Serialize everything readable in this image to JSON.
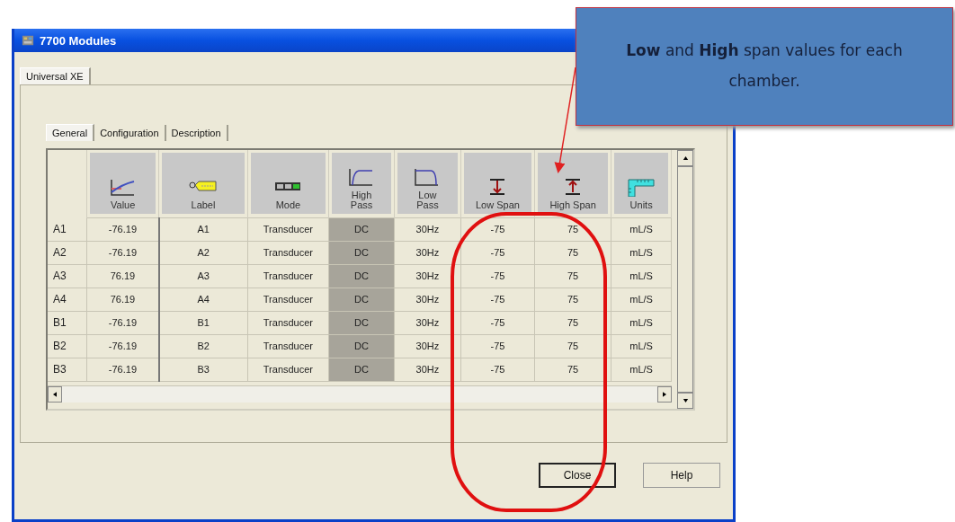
{
  "window": {
    "title": "7700 Modules"
  },
  "outer_tabs": [
    {
      "label": "Universal XE",
      "selected": true
    }
  ],
  "inner_tabs": [
    {
      "label": "General",
      "selected": true
    },
    {
      "label": "Configuration",
      "selected": false
    },
    {
      "label": "Description",
      "selected": false
    }
  ],
  "table": {
    "columns": [
      {
        "kind": "value",
        "label": "Value",
        "selected": false
      },
      {
        "kind": "label",
        "label": "Label",
        "selected": false
      },
      {
        "kind": "mode",
        "label": "Mode",
        "selected": false
      },
      {
        "kind": "highpass",
        "label": "High Pass",
        "selected": true
      },
      {
        "kind": "lowpass",
        "label": "Low Pass",
        "selected": false
      },
      {
        "kind": "lowspan",
        "label": "Low Span",
        "selected": false
      },
      {
        "kind": "highspan",
        "label": "High Span",
        "selected": false
      },
      {
        "kind": "units",
        "label": "Units",
        "selected": false
      }
    ],
    "rows": [
      {
        "header": "A1",
        "cells": [
          "-76.19",
          "A1",
          "Transducer",
          "DC",
          "30Hz",
          "-75",
          "75",
          "mL/S"
        ]
      },
      {
        "header": "A2",
        "cells": [
          "-76.19",
          "A2",
          "Transducer",
          "DC",
          "30Hz",
          "-75",
          "75",
          "mL/S"
        ]
      },
      {
        "header": "A3",
        "cells": [
          "76.19",
          "A3",
          "Transducer",
          "DC",
          "30Hz",
          "-75",
          "75",
          "mL/S"
        ]
      },
      {
        "header": "A4",
        "cells": [
          "76.19",
          "A4",
          "Transducer",
          "DC",
          "30Hz",
          "-75",
          "75",
          "mL/S"
        ]
      },
      {
        "header": "B1",
        "cells": [
          "-76.19",
          "B1",
          "Transducer",
          "DC",
          "30Hz",
          "-75",
          "75",
          "mL/S"
        ]
      },
      {
        "header": "B2",
        "cells": [
          "-76.19",
          "B2",
          "Transducer",
          "DC",
          "30Hz",
          "-75",
          "75",
          "mL/S"
        ]
      },
      {
        "header": "B3",
        "cells": [
          "-76.19",
          "B3",
          "Transducer",
          "DC",
          "30Hz",
          "-75",
          "75",
          "mL/S"
        ]
      }
    ]
  },
  "buttons": [
    {
      "label": "Close",
      "default": true
    },
    {
      "label": "Help",
      "default": false
    }
  ],
  "callout": {
    "text": "**Low** and **High** span values for each chamber."
  }
}
